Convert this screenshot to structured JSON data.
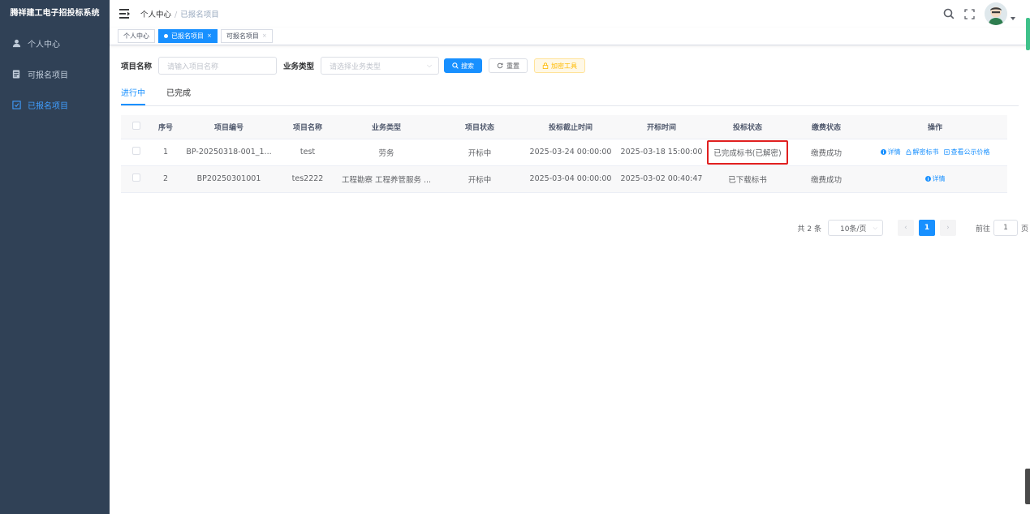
{
  "app": {
    "title": "腾祥建工电子招投标系统"
  },
  "sidebar": {
    "items": [
      {
        "label": "个人中心",
        "icon": "user-icon",
        "active": false
      },
      {
        "label": "可报名项目",
        "icon": "document-icon",
        "active": false
      },
      {
        "label": "已报名项目",
        "icon": "checklist-icon",
        "active": true
      }
    ]
  },
  "header": {
    "breadcrumb": {
      "home": "个人中心",
      "separator": "/",
      "current": "已报名项目"
    }
  },
  "tags": [
    {
      "label": "个人中心",
      "closable": false,
      "active": false
    },
    {
      "label": "已报名项目",
      "closable": true,
      "active": true
    },
    {
      "label": "可报名项目",
      "closable": true,
      "active": false
    }
  ],
  "search": {
    "project_name_label": "项目名称",
    "project_name_placeholder": "请输入项目名称",
    "business_type_label": "业务类型",
    "business_type_placeholder": "请选择业务类型",
    "search_btn": "搜索",
    "reset_btn": "重置",
    "decrypt_tool_btn": "加密工具"
  },
  "tabs": [
    {
      "label": "进行中",
      "active": true
    },
    {
      "label": "已完成",
      "active": false
    }
  ],
  "table": {
    "headers": [
      "序号",
      "项目编号",
      "项目名称",
      "业务类型",
      "项目状态",
      "投标截止时间",
      "开标时间",
      "投标状态",
      "缴费状态",
      "操作"
    ],
    "rows": [
      {
        "index": "1",
        "code": "BP-20250318-001_1...",
        "name": "test",
        "type": "劳务",
        "status": "开标中",
        "deadline": "2025-03-24 00:00:00",
        "open_time": "2025-03-18 15:00:00",
        "bid_status": "已完成标书(已解密)",
        "pay_status": "缴费成功",
        "ops": [
          "详情",
          "解密标书",
          "查看公示价格"
        ]
      },
      {
        "index": "2",
        "code": "BP20250301001",
        "name": "tes2222",
        "type": "工程勘察 工程养管服务 ...",
        "status": "开标中",
        "deadline": "2025-03-04 00:00:00",
        "open_time": "2025-03-02 00:40:47",
        "bid_status": "已下载标书",
        "pay_status": "缴费成功",
        "ops": [
          "详情"
        ]
      }
    ]
  },
  "pagination": {
    "total": "共 2 条",
    "page_size": "10条/页",
    "current_page": "1",
    "goto_label": "前往",
    "goto_value": "1",
    "page_suffix": "页"
  },
  "colors": {
    "sidebar_bg": "#304156",
    "primary": "#1890ff",
    "highlight": "#e02020"
  }
}
